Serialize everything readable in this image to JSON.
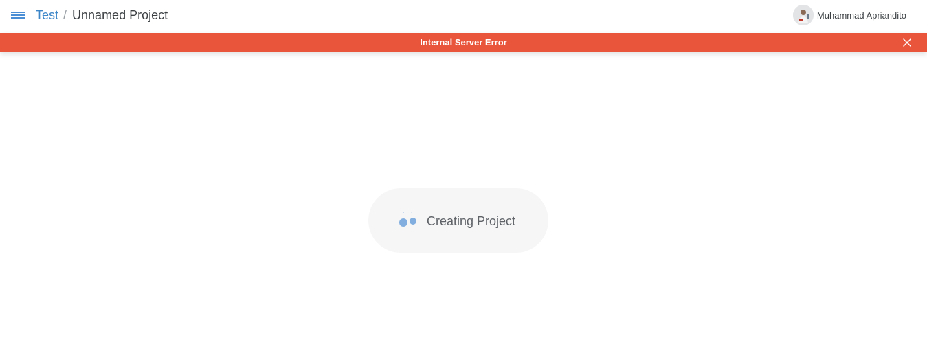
{
  "header": {
    "menu_icon": "hamburger-icon",
    "breadcrumb": {
      "parent": "Test",
      "separator": "/",
      "current": "Unnamed Project"
    },
    "user": {
      "name": "Muhammad Apriandito",
      "avatar_icon": "user-avatar"
    }
  },
  "error_banner": {
    "message": "Internal Server Error",
    "close_icon": "close-icon",
    "background_color": "#e8553a"
  },
  "loading": {
    "message": "Creating Project",
    "spinner_icon": "loading-dots-icon",
    "accent_color": "#4a8fd6"
  }
}
